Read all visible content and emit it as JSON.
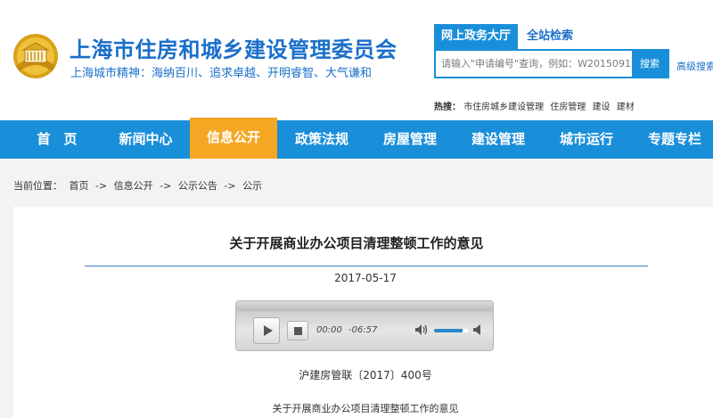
{
  "header": {
    "site_title": "上海市住房和城乡建设管理委员会",
    "motto": "上海城市精神：海纳百川、追求卓越、开明睿智、大气谦和",
    "logo_icon": "city-emblem-icon"
  },
  "search": {
    "tab_active": "网上政务大厅",
    "tab_other": "全站检索",
    "placeholder": "请输入\"申请编号\"查询，例如：W2015091",
    "button": "搜索",
    "advanced": "高级搜索",
    "hot_label": "热搜：",
    "hot_items": [
      "市住房城乡建设管理",
      "住房管理",
      "建设",
      "建材"
    ]
  },
  "nav": {
    "items": [
      "首　页",
      "新闻中心",
      "信息公开",
      "政策法规",
      "房屋管理",
      "建设管理",
      "城市运行",
      "专题专栏"
    ],
    "active_index": 2,
    "active_color": "#f5a623",
    "bar_color": "#1a8fd9"
  },
  "breadcrumb": {
    "label": "当前位置：",
    "items": [
      "首页",
      "->",
      "信息公开",
      "->",
      "公示公告",
      "->",
      "公示"
    ]
  },
  "article": {
    "title": "关于开展商业办公项目清理整顿工作的意见",
    "date": "2017-05-17",
    "doc_number": "沪建房管联〔2017〕400号",
    "first_line": "关于开展商业办公项目清理整顿工作的意见"
  },
  "player": {
    "current_time": "00:00",
    "remaining_time": "-06:57",
    "volume": 0.85
  }
}
